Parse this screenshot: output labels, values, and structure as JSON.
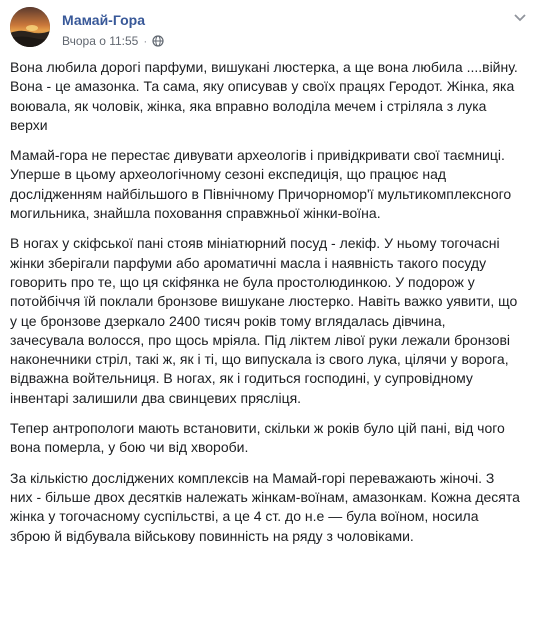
{
  "post": {
    "author": "Мамай-Гора",
    "time": "Вчора о 11:55",
    "separator": "·",
    "privacy_icon": "globe-icon",
    "more_icon": "chevron-down-icon",
    "paragraphs": [
      "Вона любила дорогі парфуми, вишукані люстерка, а ще вона любила ....війну. Вона - це амазонка. Та сама, яку описував у своїх працях Геродот. Жінка, яка воювала, як чоловік, жінка, яка вправно володіла мечем і стріляла з лука верхи",
      "Мамай-гора не перестає дивувати археологів і привідкривати свої таємниці. Уперше в цьому археологічному сезоні експедиція, що працює над дослідженням найбільшого в Північному Причорномор'ї мультикомплексного могильника, знайшла поховання справжньої жінки-воїна.",
      "В ногах у скіфської пані стояв мініатюрний посуд - лекіф. У ньому тогочасні жінки зберігали парфуми або ароматичні масла і наявність такого посуду говорить про те, що ця скіфянка не була простолюдинкою. У подорож у потойбіччя їй поклали бронзове вишукане люстерко. Навіть важко уявити, що у це бронзове дзеркало 2400 тисяч років тому вглядалась дівчина, зачесувала волосся, про щось мріяла. Під ліктем лівої руки лежали бронзові наконечники стріл, такі ж, як і ті, що випускала із свого лука, цілячи у ворога, відважна войтельниця. В ногах, як і годиться господині, у супровідному інвентарі залишили два свинцевих прясліця.",
      "Тепер антропологи мають встановити, скільки ж років було цій пані, від чого вона померла, у бою чи від хвороби.",
      "За кількістю досліджених комплексів на Мамай-горі переважають жіночі. З них - більше двох десятків належать жінкам-воїнам, амазонкам. Кожна десята жінка у тогочасному суспільстві, а це 4 ст. до н.е — була воїном, носила зброю й відбувала військову повинність на ряду з чоловіками."
    ]
  },
  "colors": {
    "author": "#385898",
    "text": "#1c1e21",
    "meta": "#616770"
  }
}
